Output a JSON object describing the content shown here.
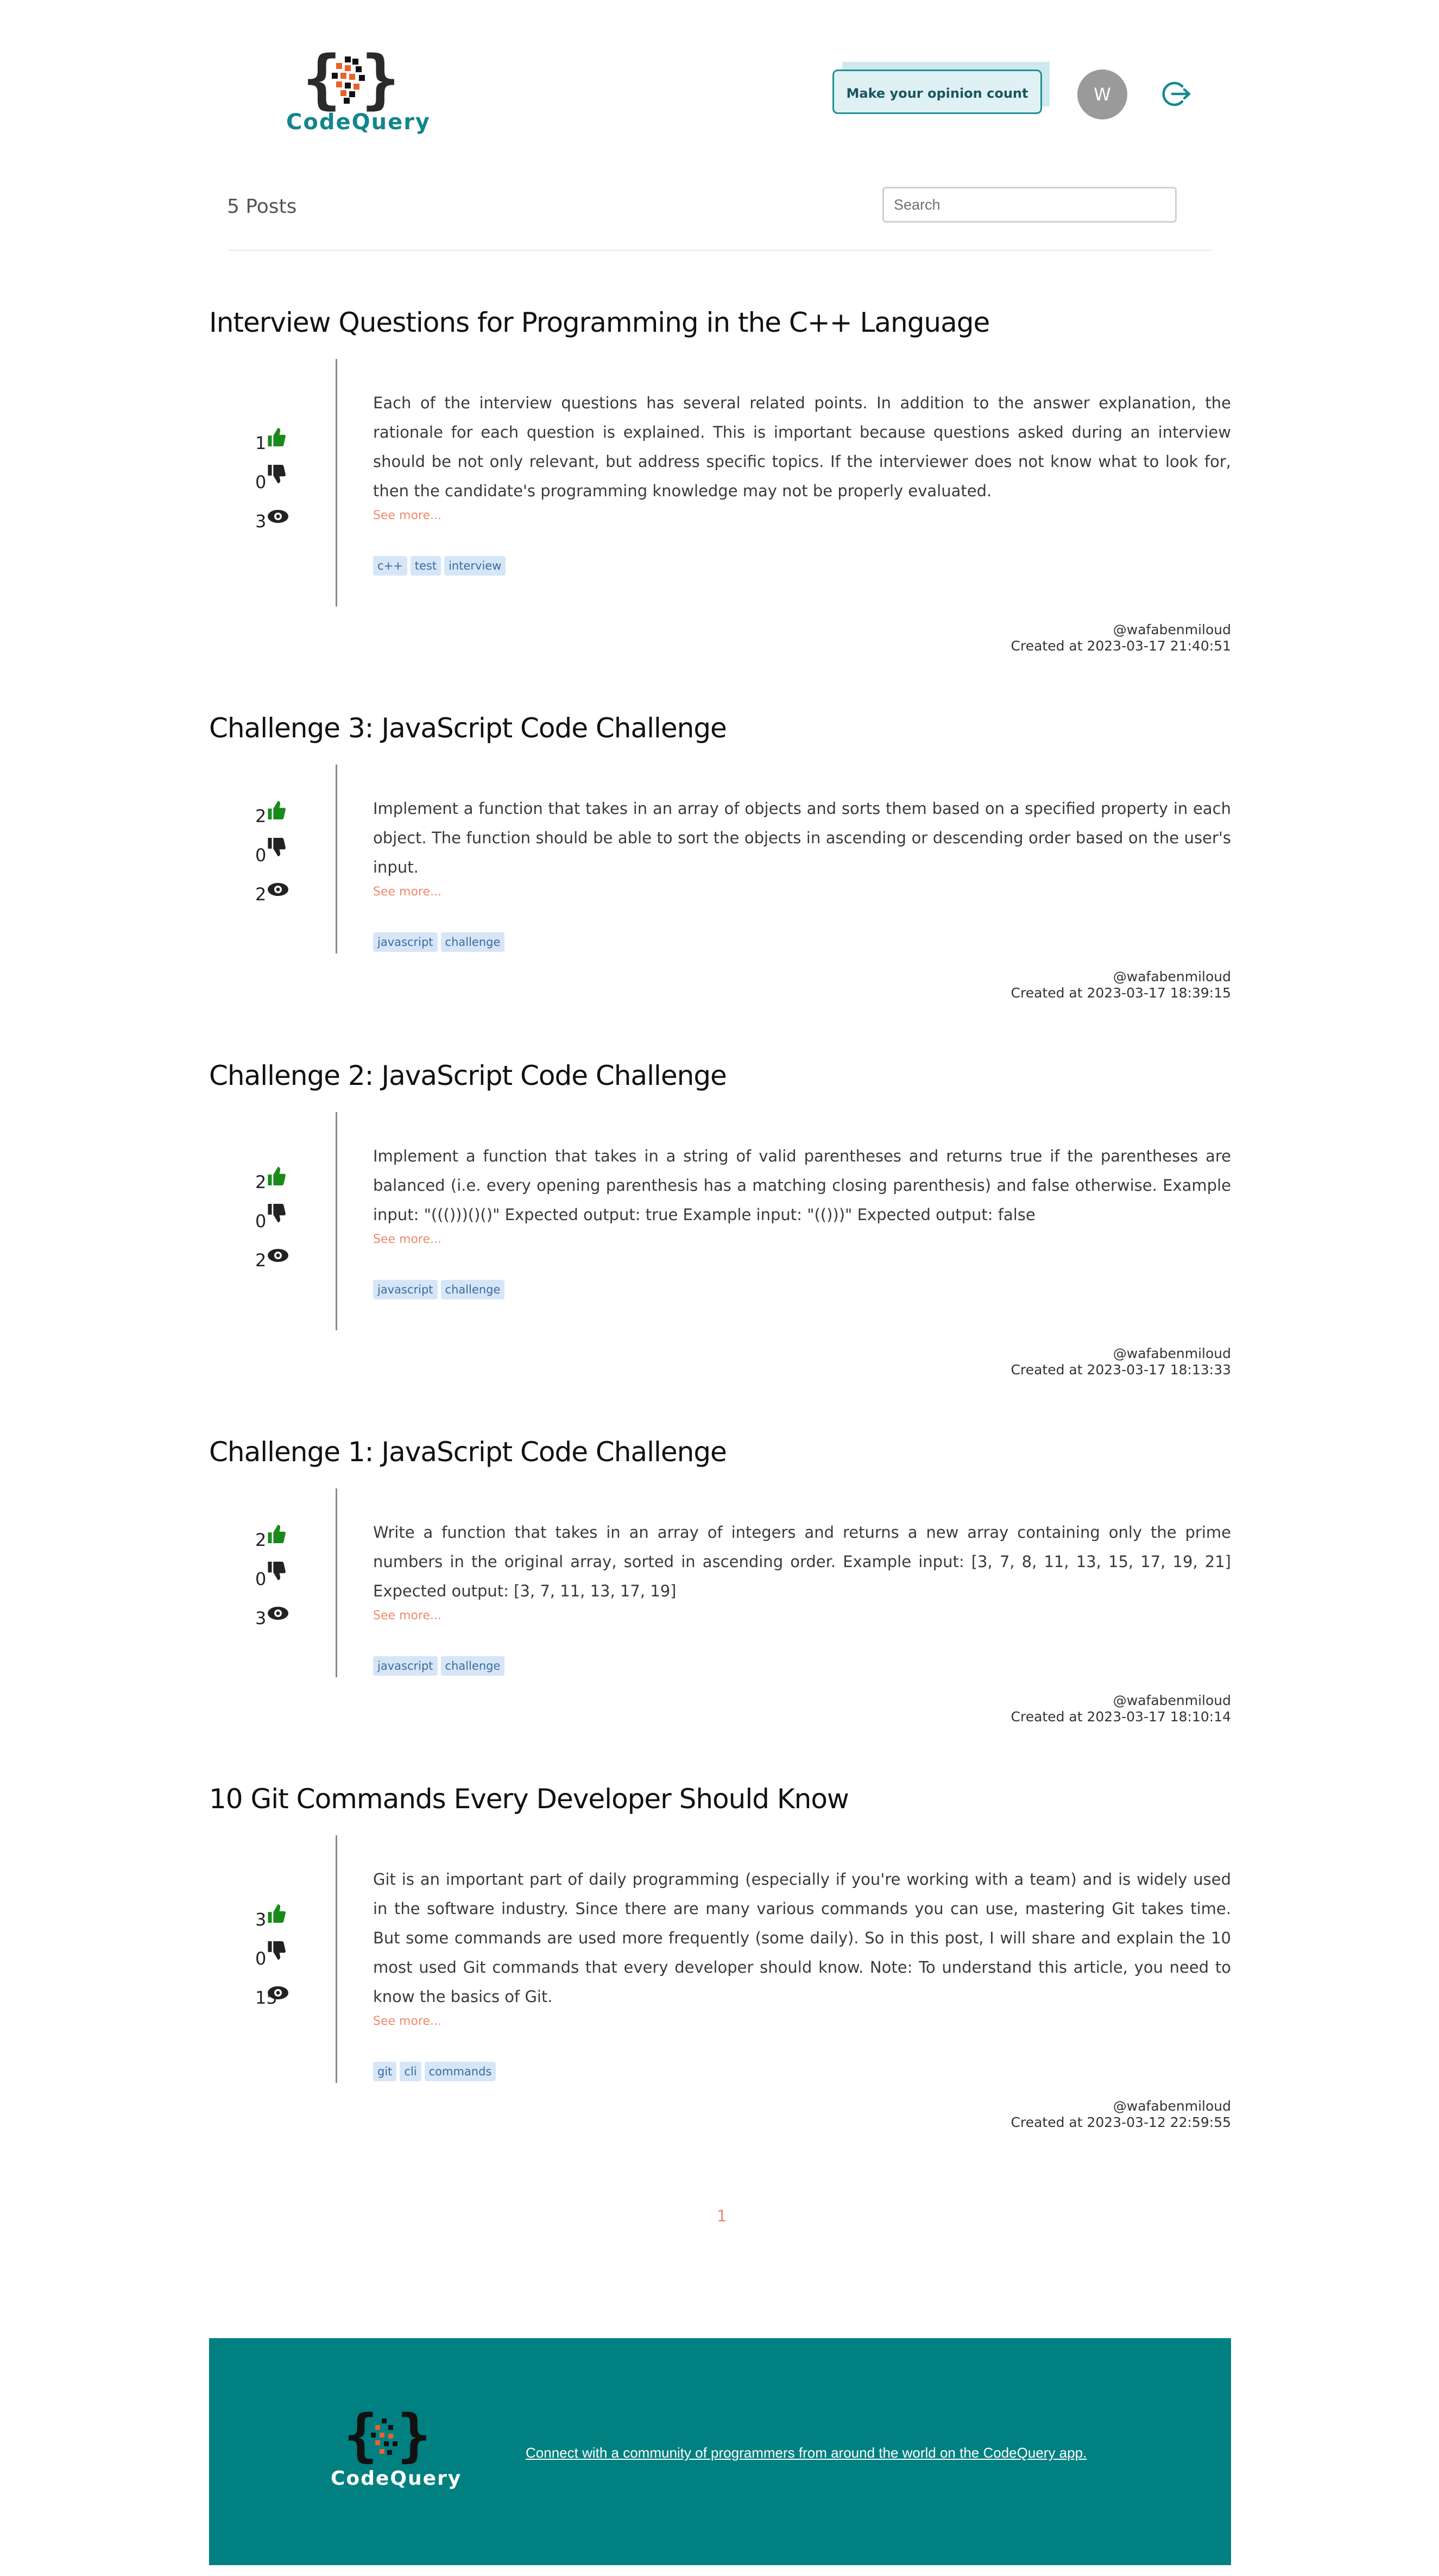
{
  "header": {
    "logo_text": "CodeQuery",
    "opinion_button": "Make your opinion count",
    "avatar_letter": "W",
    "logout_icon": "logout-icon"
  },
  "toolbar": {
    "posts_count": "5 Posts",
    "search_placeholder": "Search"
  },
  "posts": [
    {
      "title": "Interview Questions for Programming in the C++ Language",
      "likes": "1",
      "dislikes": "0",
      "views": "3",
      "excerpt": "Each of the interview questions has several related points. In addition to the answer explanation, the rationale for each question is explained. This is important because questions asked during an interview should be not only relevant, but address specific topics. If the interviewer does not know what to look for, then the candidate's programming knowledge may not be properly evaluated.",
      "see_more": "See more...",
      "tags": [
        "c++",
        "test",
        "interview"
      ],
      "author": "@wafabenmiloud",
      "created": "Created at 2023-03-17 21:40:51"
    },
    {
      "title": "Challenge 3: JavaScript Code Challenge",
      "likes": "2",
      "dislikes": "0",
      "views": "2",
      "excerpt": "Implement a function that takes in an array of objects and sorts them based on a specified property in each object. The function should be able to sort the objects in ascending or descending order based on the user's input.",
      "see_more": "See more...",
      "tags": [
        "javascript",
        "challenge"
      ],
      "author": "@wafabenmiloud",
      "created": "Created at 2023-03-17 18:39:15"
    },
    {
      "title": "Challenge 2: JavaScript Code Challenge",
      "likes": "2",
      "dislikes": "0",
      "views": "2",
      "excerpt": "Implement a function that takes in a string of valid parentheses and returns true if the parentheses are balanced (i.e. every opening parenthesis has a matching closing parenthesis) and false otherwise. Example input: \"((()))()()\" Expected output: true Example input: \"(()))\" Expected output: false",
      "see_more": "See more...",
      "tags": [
        "javascript",
        "challenge"
      ],
      "author": "@wafabenmiloud",
      "created": "Created at 2023-03-17 18:13:33"
    },
    {
      "title": "Challenge 1: JavaScript Code Challenge",
      "likes": "2",
      "dislikes": "0",
      "views": "3",
      "excerpt": "Write a function that takes in an array of integers and returns a new array containing only the prime numbers in the original array, sorted in ascending order. Example input: [3, 7, 8, 11, 13, 15, 17, 19, 21] Expected output: [3, 7, 11, 13, 17, 19]",
      "see_more": "See more...",
      "tags": [
        "javascript",
        "challenge"
      ],
      "author": "@wafabenmiloud",
      "created": "Created at 2023-03-17 18:10:14"
    },
    {
      "title": "10 Git Commands Every Developer Should Know",
      "likes": "3",
      "dislikes": "0",
      "views": "15",
      "excerpt": "Git is an important part of daily programming (especially if you're working with a team) and is widely used in the software industry. Since there are many various commands you can use, mastering Git takes time. But some commands are used more frequently (some daily). So in this post, I will share and explain the 10 most used Git commands that every developer should know. Note: To understand this article, you need to know the basics of Git.",
      "see_more": "See more...",
      "tags": [
        "git",
        "cli",
        "commands"
      ],
      "author": "@wafabenmiloud",
      "created": "Created at 2023-03-12 22:59:55"
    }
  ],
  "pagination": {
    "current": "1"
  },
  "footer": {
    "logo_text": "CodeQuery",
    "link_text": "Connect with a community of programmers from around the world on the CodeQuery app."
  },
  "colors": {
    "teal": "#008080",
    "accent_orange": "#f0896c",
    "like_green": "#1a8a1a",
    "tag_bg": "#d6e6f7"
  }
}
